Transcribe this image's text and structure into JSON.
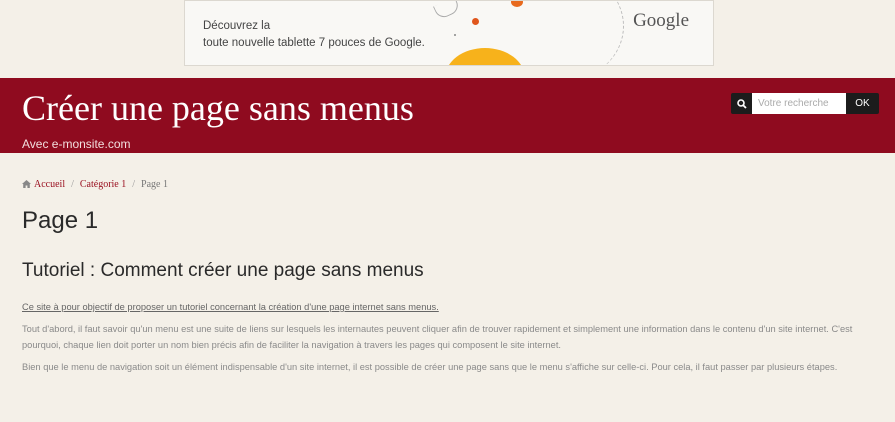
{
  "ad": {
    "text_line1": "Découvrez la",
    "text_line2": "toute nouvelle tablette 7 pouces de Google.",
    "brand": "Google"
  },
  "header": {
    "title": "Créer une page sans menus",
    "subtitle": "Avec e-monsite.com",
    "background_color": "#8f0b1f"
  },
  "search": {
    "icon": "search-icon",
    "placeholder": "Votre recherche",
    "value": "",
    "button_label": "OK"
  },
  "breadcrumb": {
    "home_icon": "home-icon",
    "items": [
      "Accueil",
      "Catégorie 1",
      "Page 1"
    ],
    "separator": "/"
  },
  "main": {
    "title": "Page 1",
    "heading": "Tutoriel : Comment créer une page sans menus",
    "paragraphs": [
      "Ce site à pour objectif de proposer un tutoriel concernant la création d'une page internet sans menus.",
      "Tout d'abord, il faut savoir qu'un menu est une suite de liens sur lesquels les internautes peuvent cliquer afin de trouver rapidement et simplement une information dans le contenu d'un site internet. C'est pourquoi, chaque lien doit porter un nom bien précis afin de faciliter la navigation à travers les pages qui composent le site internet.",
      "Bien que le menu de navigation soit un élément indispensable d'un site internet, il est possible de créer une page sans que le menu s'affiche sur celle-ci. Pour cela, il faut passer par plusieurs étapes."
    ]
  },
  "colors": {
    "accent": "#8f0b1f",
    "link": "#9a1020",
    "background": "#f4f0e8"
  }
}
